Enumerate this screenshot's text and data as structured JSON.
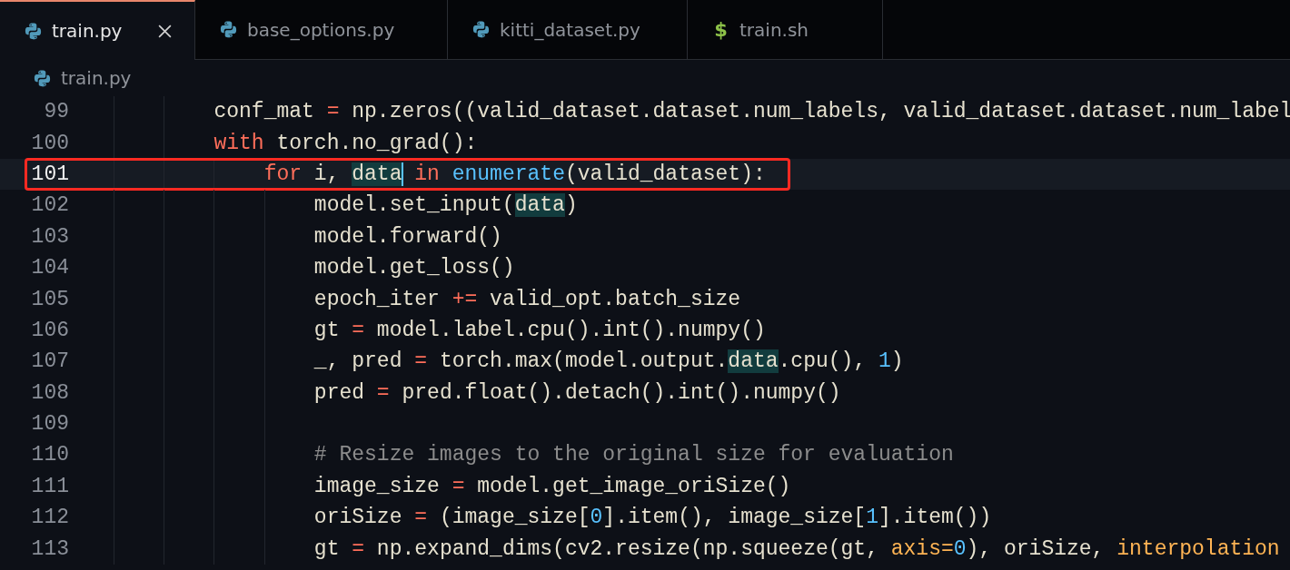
{
  "tabs": [
    {
      "label": "train.py",
      "selected": true,
      "icon": {
        "kind": "python"
      }
    },
    {
      "label": "base_options.py",
      "selected": false,
      "icon": {
        "kind": "python"
      }
    },
    {
      "label": "kitti_dataset.py",
      "selected": false,
      "icon": {
        "kind": "python"
      }
    },
    {
      "label": "train.sh",
      "selected": false,
      "icon": {
        "kind": "glyph",
        "glyph": "$"
      }
    }
  ],
  "breadcrumb": {
    "label": "train.py",
    "icon": {
      "kind": "python"
    }
  },
  "editor": {
    "lines": [
      {
        "number": "99",
        "current": false,
        "boxed": false,
        "tokens": [
          {
            "kind": "plain",
            "text": "        conf_mat "
          },
          {
            "kind": "keyword",
            "text": "="
          },
          {
            "kind": "plain",
            "text": " np.zeros((valid_dataset.dataset.num_labels, valid_dataset.dataset.num_label"
          }
        ]
      },
      {
        "number": "100",
        "current": false,
        "boxed": false,
        "tokens": [
          {
            "kind": "keyword",
            "text": "        with"
          },
          {
            "kind": "plain",
            "text": " torch.no_grad():"
          }
        ]
      },
      {
        "number": "101",
        "current": true,
        "boxed": true,
        "tokens": [
          {
            "kind": "keyword",
            "text": "            for"
          },
          {
            "kind": "plain",
            "text": " i, "
          },
          {
            "kind": "match",
            "text": "data"
          },
          {
            "kind": "caret"
          },
          {
            "kind": "keyword",
            "text": " in"
          },
          {
            "kind": "function",
            "text": " enumerate"
          },
          {
            "kind": "plain",
            "text": "(valid_dataset):"
          }
        ]
      },
      {
        "number": "102",
        "current": false,
        "boxed": false,
        "tokens": [
          {
            "kind": "plain",
            "text": "                model.set_input("
          },
          {
            "kind": "match",
            "text": "data"
          },
          {
            "kind": "plain",
            "text": ")"
          }
        ]
      },
      {
        "number": "103",
        "current": false,
        "boxed": false,
        "tokens": [
          {
            "kind": "plain",
            "text": "                model.forward()"
          }
        ]
      },
      {
        "number": "104",
        "current": false,
        "boxed": false,
        "tokens": [
          {
            "kind": "plain",
            "text": "                model.get_loss()"
          }
        ]
      },
      {
        "number": "105",
        "current": false,
        "boxed": false,
        "tokens": [
          {
            "kind": "plain",
            "text": "                epoch_iter "
          },
          {
            "kind": "keyword",
            "text": "+="
          },
          {
            "kind": "plain",
            "text": " valid_opt.batch_size"
          }
        ]
      },
      {
        "number": "106",
        "current": false,
        "boxed": false,
        "tokens": [
          {
            "kind": "plain",
            "text": "                gt "
          },
          {
            "kind": "keyword",
            "text": "="
          },
          {
            "kind": "plain",
            "text": " model.label.cpu().int().numpy()"
          }
        ]
      },
      {
        "number": "107",
        "current": false,
        "boxed": false,
        "tokens": [
          {
            "kind": "plain",
            "text": "                _, pred "
          },
          {
            "kind": "keyword",
            "text": "="
          },
          {
            "kind": "plain",
            "text": " torch.max(model.output."
          },
          {
            "kind": "match",
            "text": "data"
          },
          {
            "kind": "plain",
            "text": ".cpu(), "
          },
          {
            "kind": "number",
            "text": "1"
          },
          {
            "kind": "plain",
            "text": ")"
          }
        ]
      },
      {
        "number": "108",
        "current": false,
        "boxed": false,
        "tokens": [
          {
            "kind": "plain",
            "text": "                pred "
          },
          {
            "kind": "keyword",
            "text": "="
          },
          {
            "kind": "plain",
            "text": " pred.float().detach().int().numpy()"
          }
        ]
      },
      {
        "number": "109",
        "current": false,
        "boxed": false
      },
      {
        "number": "110",
        "current": false,
        "boxed": false,
        "tokens": [
          {
            "kind": "comment",
            "text": "                # Resize images to the original size for evaluation"
          }
        ]
      },
      {
        "number": "111",
        "current": false,
        "boxed": false,
        "tokens": [
          {
            "kind": "plain",
            "text": "                image_size "
          },
          {
            "kind": "keyword",
            "text": "="
          },
          {
            "kind": "plain",
            "text": " model.get_image_oriSize()"
          }
        ]
      },
      {
        "number": "112",
        "current": false,
        "boxed": false,
        "tokens": [
          {
            "kind": "plain",
            "text": "                oriSize "
          },
          {
            "kind": "keyword",
            "text": "="
          },
          {
            "kind": "plain",
            "text": " (image_size["
          },
          {
            "kind": "number",
            "text": "0"
          },
          {
            "kind": "plain",
            "text": "].item(), image_size["
          },
          {
            "kind": "number",
            "text": "1"
          },
          {
            "kind": "plain",
            "text": "].item())"
          }
        ]
      },
      {
        "number": "113",
        "current": false,
        "boxed": false,
        "tokens": [
          {
            "kind": "plain",
            "text": "                gt "
          },
          {
            "kind": "keyword",
            "text": "="
          },
          {
            "kind": "plain",
            "text": " np.expand_dims(cv2.resize(np.squeeze(gt, "
          },
          {
            "kind": "param",
            "text": "axis="
          },
          {
            "kind": "number",
            "text": "0"
          },
          {
            "kind": "plain",
            "text": "), oriSize, "
          },
          {
            "kind": "param",
            "text": "interpolation"
          }
        ]
      }
    ]
  }
}
